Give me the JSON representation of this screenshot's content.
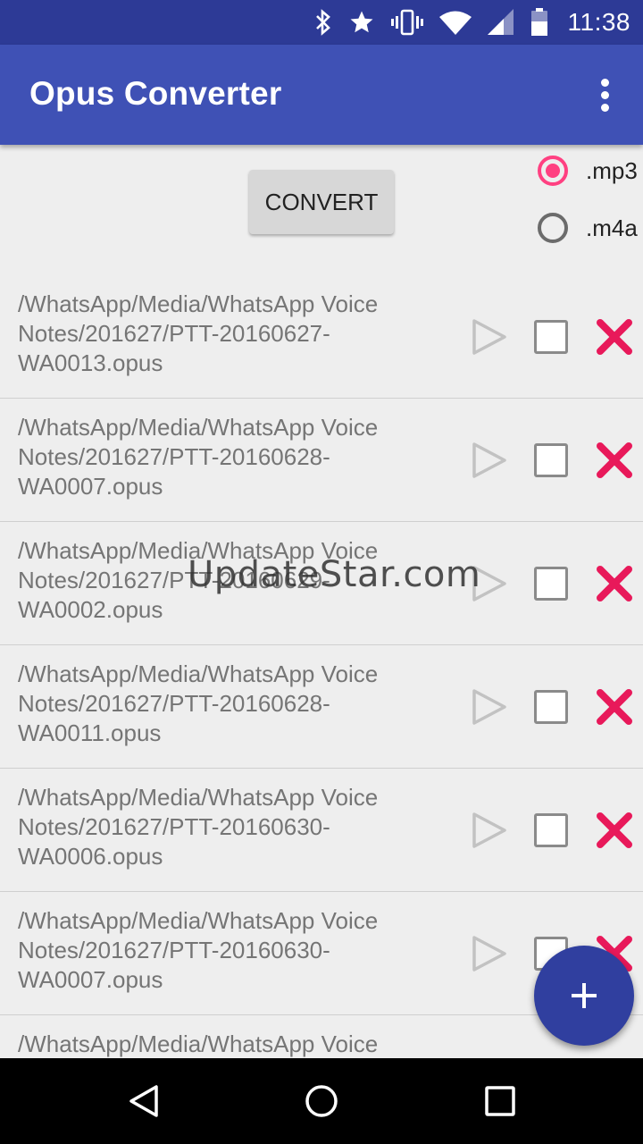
{
  "status_bar": {
    "time": "11:38",
    "icons": [
      "bluetooth-icon",
      "star-icon",
      "vibrate-icon",
      "wifi-icon",
      "cell-signal-icon",
      "battery-icon"
    ]
  },
  "app_bar": {
    "title": "Opus Converter",
    "menu_icon": "more-vert-icon",
    "color": "#3f51b5"
  },
  "controls": {
    "convert_label": "CONVERT",
    "formats": [
      {
        "label": ".mp3",
        "selected": true
      },
      {
        "label": ".m4a",
        "selected": false
      }
    ]
  },
  "files": [
    {
      "path": "/WhatsApp/Media/WhatsApp Voice Notes/201627/PTT-20160627-WA0013.opus",
      "checked": false
    },
    {
      "path": "/WhatsApp/Media/WhatsApp Voice Notes/201627/PTT-20160628-WA0007.opus",
      "checked": false
    },
    {
      "path": "/WhatsApp/Media/WhatsApp Voice Notes/201627/PTT-20160629-WA0002.opus",
      "checked": false
    },
    {
      "path": "/WhatsApp/Media/WhatsApp Voice Notes/201627/PTT-20160628-WA0011.opus",
      "checked": false
    },
    {
      "path": "/WhatsApp/Media/WhatsApp Voice Notes/201627/PTT-20160630-WA0006.opus",
      "checked": false
    },
    {
      "path": "/WhatsApp/Media/WhatsApp Voice Notes/201627/PTT-20160630-WA0007.opus",
      "checked": false
    },
    {
      "path": "/WhatsApp/Media/WhatsApp Voice",
      "checked": false
    }
  ],
  "watermark": "UpdateStar.com",
  "fab": {
    "icon": "plus-icon",
    "color": "#303f9f"
  },
  "nav_bar": {
    "icons": [
      "back-icon",
      "home-icon",
      "recents-icon"
    ]
  },
  "colors": {
    "accent": "#ff4081",
    "delete": "#e8195a"
  }
}
